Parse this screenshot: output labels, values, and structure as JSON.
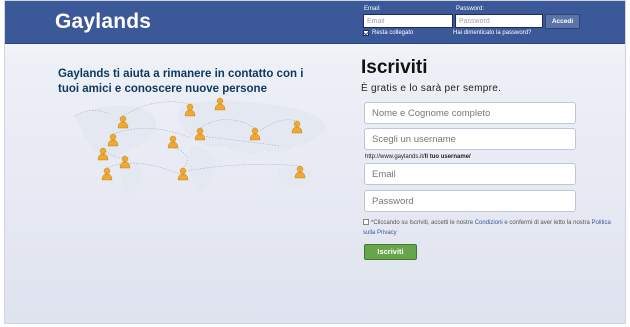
{
  "header": {
    "logo": "Gaylands",
    "email_label": "Email:",
    "email_placeholder": "Email",
    "password_label": "Password:",
    "password_placeholder": "Password",
    "login_button": "Accedi",
    "remember_me": "Resta collegato",
    "forgot_password": "Hai dimenticato la password?"
  },
  "intro": {
    "tagline": "Gaylands ti aiuta a rimanere in contatto con i tuoi amici e conoscere nuove persone"
  },
  "signup": {
    "title": "Iscriviti",
    "subtitle": "È gratis e lo sarà per sempre.",
    "fullname_placeholder": "Nome e Cognome completo",
    "username_placeholder": "Scegli un username",
    "url_prefix": "http://www.gaylands.it/",
    "url_suffix": "Il tuo username/",
    "email_placeholder": "Email",
    "password_placeholder": "Password",
    "terms_prefix": "*Cliccando su Iscriviti, accetti le nostre ",
    "terms_link": "Condizioni",
    "terms_middle": " e confermi di aver letto la nostra ",
    "privacy_link": "Politica sulla Privacy",
    "button": "Iscriviti"
  },
  "colors": {
    "topbar": "#3b5998",
    "tagline": "#0e385f",
    "signup_button": "#67a54b",
    "person_icon": "#f0a830"
  },
  "icons": [
    "person-icon",
    "checkbox-icon"
  ]
}
